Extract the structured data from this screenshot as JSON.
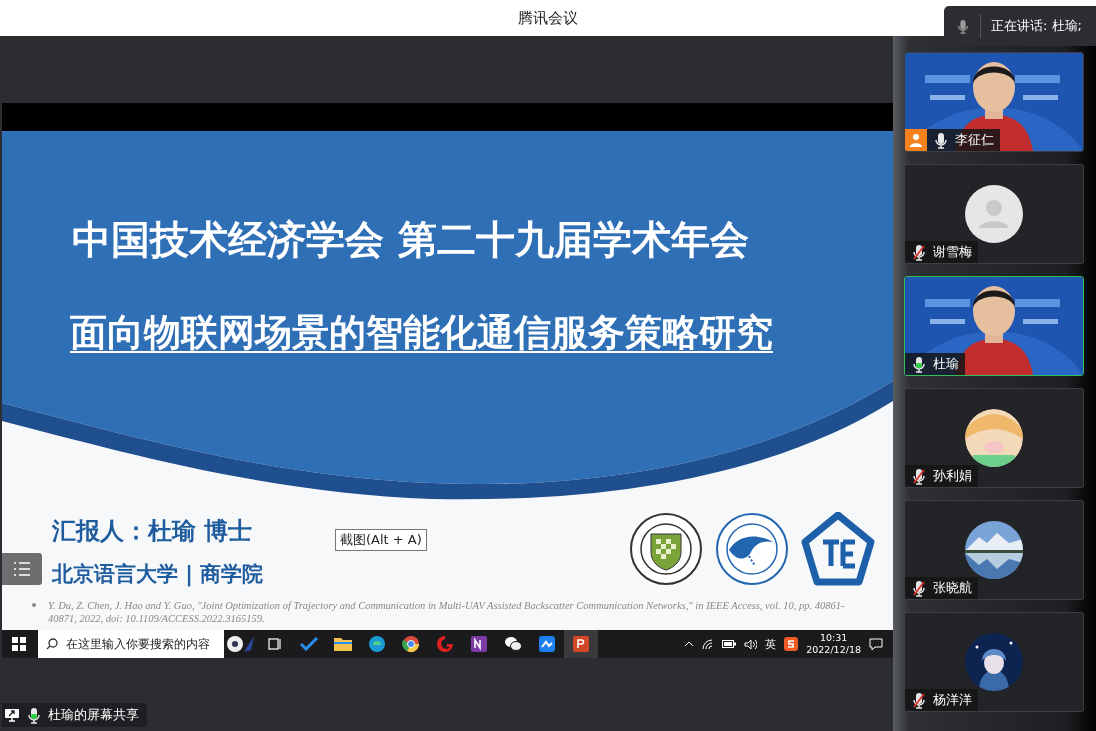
{
  "window": {
    "title": "腾讯会议"
  },
  "speaking_banner": {
    "label": "正在讲话: 杜瑜;"
  },
  "shared_screen": {
    "slide": {
      "title": "中国技术经济学会 第二十九届学术年会",
      "subtitle": "面向物联网场景的智能化通信服务策略研究",
      "presenter": "汇报人：杜瑜 博士",
      "affiliation": "北京语言大学 | 商学院",
      "reference": "Y. Du, Z. Chen, J. Hao and Y. Guo, \"Joint Optimization of Trajectory and Communication in Multi-UAV Assisted Backscatter Communication Networks,\" in IEEE Access, vol. 10, pp. 40861-40871, 2022, doi: 10.1109/ACCESS.2022.3165159."
    },
    "tooltip": "截图(Alt + A)",
    "taskbar": {
      "search_placeholder": "在这里输入你要搜索的内容",
      "input_language": "英",
      "time": "10:31",
      "date": "2022/12/18"
    },
    "share_label": "杜瑜的屏幕共享"
  },
  "participants": [
    {
      "name": "李征仁",
      "kind": "video",
      "host": true,
      "muted": false,
      "speaking": false
    },
    {
      "name": "谢雪梅",
      "kind": "default_avatar",
      "host": false,
      "muted": true,
      "speaking": false
    },
    {
      "name": "杜瑜",
      "kind": "video",
      "host": false,
      "muted": false,
      "speaking": true
    },
    {
      "name": "孙利娟",
      "kind": "avatar",
      "host": false,
      "muted": true,
      "speaking": false
    },
    {
      "name": "张晓航",
      "kind": "avatar",
      "host": false,
      "muted": true,
      "speaking": false
    },
    {
      "name": "杨洋洋",
      "kind": "avatar",
      "host": false,
      "muted": true,
      "speaking": false
    }
  ]
}
